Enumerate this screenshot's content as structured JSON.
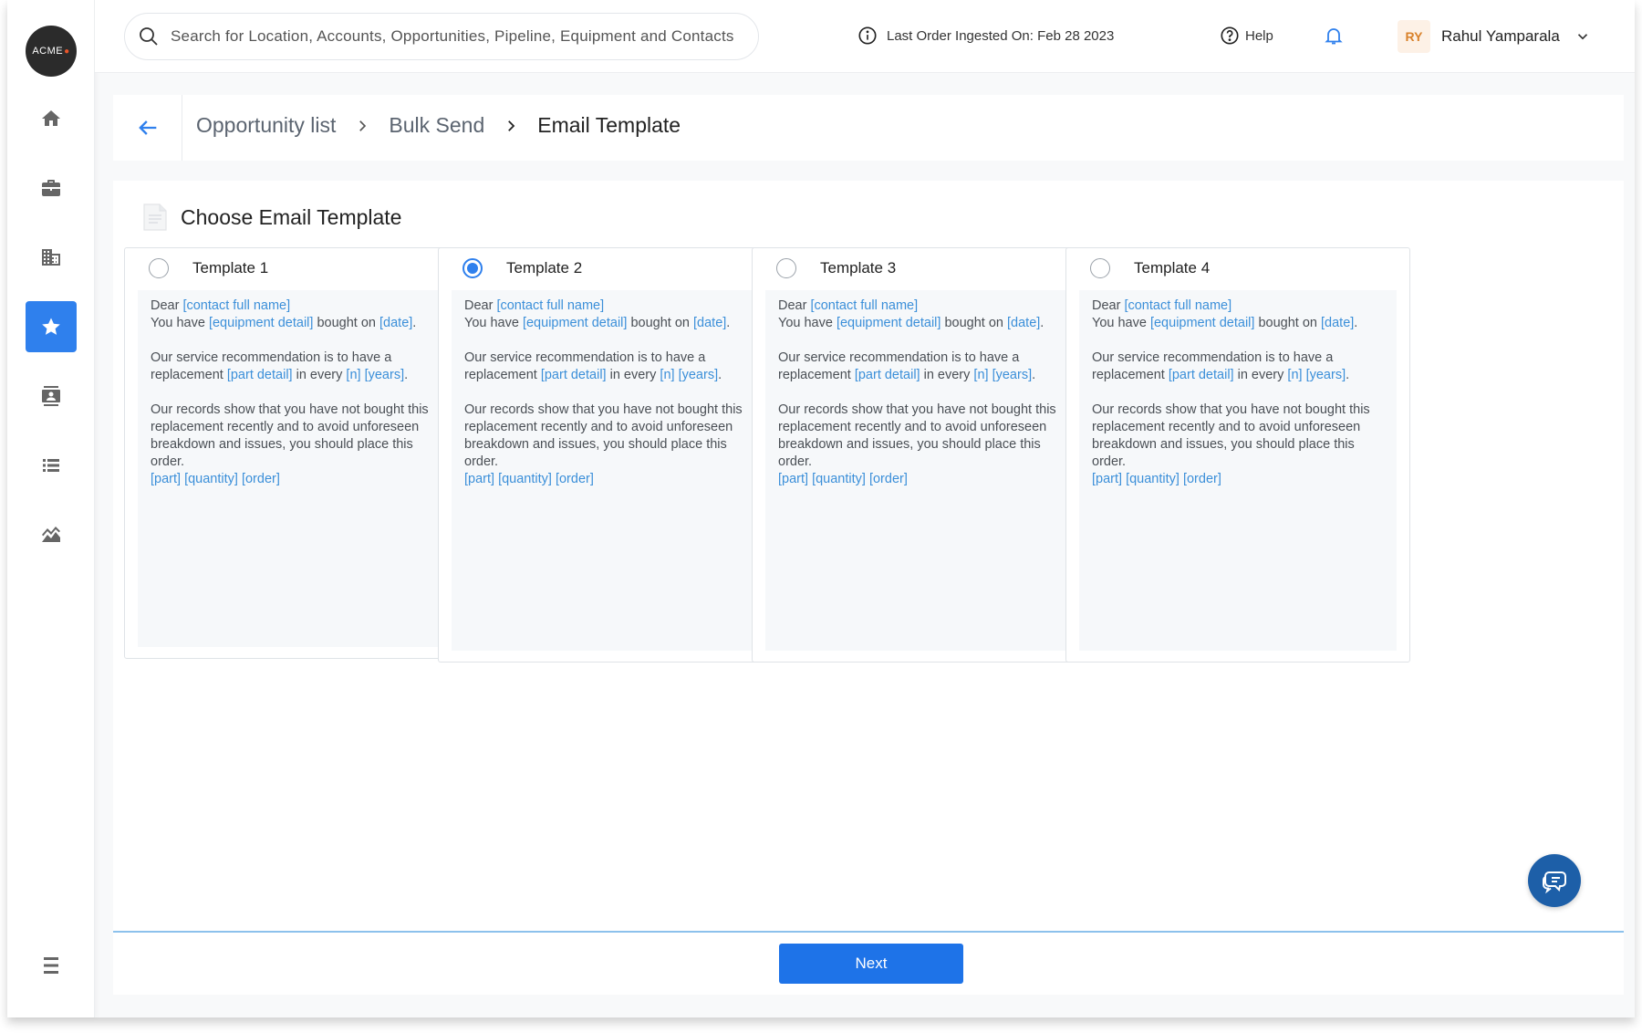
{
  "app": {
    "logo_text": "ACME",
    "logo_dot": "●"
  },
  "sidebar": {
    "items": [
      {
        "name": "home",
        "icon": "home-icon",
        "active": false
      },
      {
        "name": "accounts",
        "icon": "briefcase-icon",
        "active": false
      },
      {
        "name": "locations",
        "icon": "building-icon",
        "active": false
      },
      {
        "name": "opportunities",
        "icon": "star-icon",
        "active": true
      },
      {
        "name": "contacts",
        "icon": "contact-card-icon",
        "active": false
      },
      {
        "name": "list",
        "icon": "list-icon",
        "active": false
      },
      {
        "name": "insights",
        "icon": "chart-area-icon",
        "active": false
      }
    ],
    "menu_icon": "hamburger-menu-icon"
  },
  "topbar": {
    "search_placeholder": "Search for Location, Accounts, Opportunities, Pipeline, Equipment and Contacts",
    "last_order": "Last Order Ingested On: Feb 28 2023",
    "help_label": "Help",
    "user_initials": "RY",
    "user_name": "Rahul Yamparala"
  },
  "breadcrumb": {
    "items": [
      "Opportunity list",
      "Bulk Send",
      "Email Template"
    ]
  },
  "panel": {
    "title": "Choose Email Template",
    "selected_index": 1,
    "templates": [
      {
        "label": "Template 1"
      },
      {
        "label": "Template 2"
      },
      {
        "label": "Template 3"
      },
      {
        "label": "Template 4"
      }
    ],
    "template_body": {
      "dear": "Dear ",
      "contact_full_name": "[contact full name]",
      "you_have": "You have ",
      "equipment_detail": "[equipment detail]",
      "bought_on": " bought on ",
      "date": "[date]",
      "period": ".",
      "recommendation": "Our service recommendation is to have a replacement ",
      "part_detail": "[part detail]",
      "in_every": " in every ",
      "n": "[n]",
      "space": " ",
      "years": "[years]",
      "records": "Our records show that you have not bought this replacement recently and to avoid unforeseen breakdown and issues, you should place this order.",
      "part": "[part]",
      "quantity": "[quantity]",
      "order": "[order]"
    },
    "next_label": "Next"
  },
  "colors": {
    "accent": "#2f80ed",
    "placeholder_tag": "#3b8fd9",
    "avatar_text": "#d9822b",
    "fab": "#1d5fa8"
  }
}
